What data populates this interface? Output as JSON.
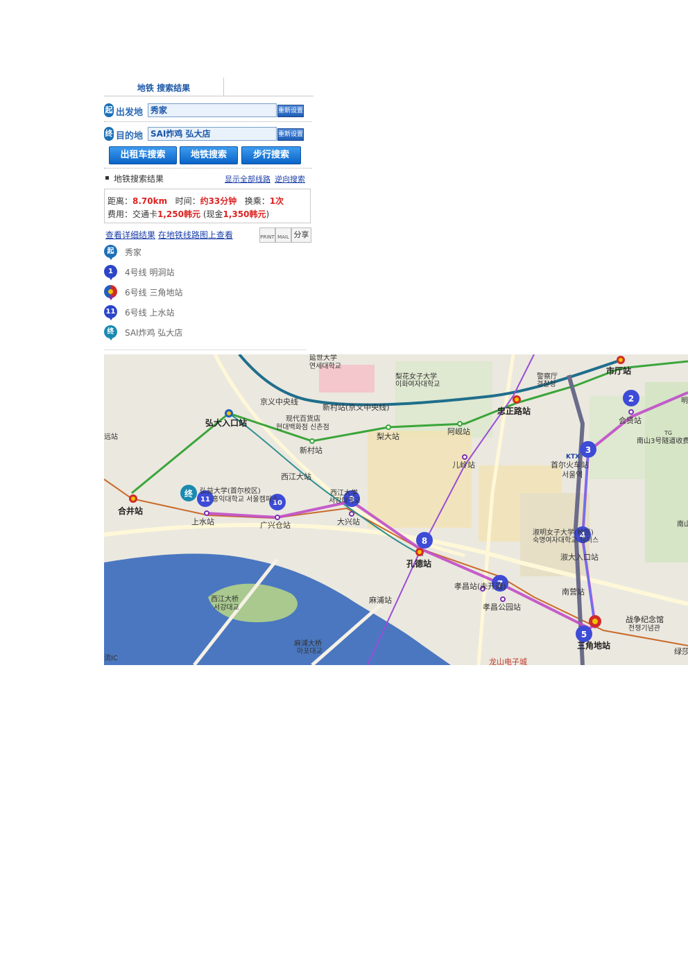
{
  "tab": {
    "label": "地铁 搜索结果"
  },
  "start": {
    "badge": "起",
    "label": "出发地",
    "value": "秀家",
    "reset": "重新设置"
  },
  "end": {
    "badge": "终",
    "label": "目的地",
    "value": "SAI炸鸡 弘大店",
    "reset": "重新设置"
  },
  "actions": {
    "taxi": "出租车搜索",
    "subway": "地铁搜索",
    "walk": "步行搜索"
  },
  "results": {
    "title": "地铁搜索结果",
    "show_all": "显示全部线路",
    "reverse": "逆向搜索",
    "distance_label": "距离：",
    "distance": "8.70km",
    "time_label": "时间：",
    "time": "约33分钟",
    "transfer_label": "换乘：",
    "transfer": "1次",
    "fare_label": "费用：交通卡",
    "fare_card": "1,250韩元",
    "fare_cash_label": "(现金",
    "fare_cash": "1,350韩元",
    "fare_close": ")"
  },
  "detail": {
    "view_detail": "查看详细结果",
    "view_map": "在地铁线路图上查看",
    "print": "PRINT",
    "mail": "MAIL",
    "share": "分享"
  },
  "steps": [
    {
      "badge": "起",
      "text": "秀家",
      "color": "#1e6fb8"
    },
    {
      "badge": "1",
      "text": "4号线 明洞站",
      "color": "#2c46c8"
    },
    {
      "badge": "",
      "text": "6号线 三角地站",
      "color": "#7a2fb0"
    },
    {
      "badge": "11",
      "text": "6号线 上水站",
      "color": "#2c46c8"
    },
    {
      "badge": "终",
      "text": "SAI炸鸡 弘大店",
      "color": "#1a8ab0"
    }
  ],
  "colors": {
    "accent": "#1a56a8",
    "route": "#c04cc8",
    "line2": "#3aa53a",
    "line6": "#a0522d",
    "river": "#4a77c0"
  },
  "map": {
    "stations": {
      "hapjeong": "合井站",
      "hongik": "弘大入口站",
      "sinchon": "新村站",
      "sinchon_gyeongui": "新村站(京义中央线)",
      "gyeongui_line": "京义中央线",
      "sogang": "西江大站",
      "sangsu": "上水站",
      "gwangheung": "广兴仓站",
      "daeheung": "大兴站",
      "gongdeok": "孔德站",
      "mapo": "麻浦站",
      "hyochang": "孝昌站(未开通)",
      "hyochangpark": "孝昌公园站",
      "ahyeon": "阿岘站",
      "edae": "梨大站",
      "aeogae": "儿岭站",
      "chungjeongno": "忠正路站",
      "cityhall": "市厅站",
      "hoehyeon": "会贤站",
      "seoulstation": "首尔火车站",
      "seoulyeok_kr": "서울역",
      "sookdae": "淑大入口站",
      "namyeong": "南营站",
      "samgakji": "三角地站",
      "nokyeong": "绿莎"
    },
    "places": {
      "yonsei": "延世大学",
      "yonsei_kr": "연세대학교",
      "ewha": "梨花女子大学",
      "ewha_kr": "이화여자대학교",
      "police": "警察厅",
      "police_kr": "경찰청",
      "hyundai": "现代百货店",
      "hyundai_kr": "현대백화점 신촌점",
      "hongik_univ": "弘益大学(首尔校区)",
      "hongik_univ_kr": "홍익대학교 서울캠퍼스",
      "sogang_univ": "西江大学",
      "sogang_univ_kr": "서강대학교",
      "sookmyung": "淑明女子大学(校区)",
      "sookmyung_kr": "숙명여자대학교 캠퍼스",
      "war_memorial": "战争纪念馆",
      "war_memorial_kr": "전쟁기념관",
      "seogang_bridge": "西江大桥",
      "seogang_bridge_kr": "서강대교",
      "mapo_bridge": "麻浦大桥",
      "mapo_bridge_kr": "마포대교",
      "yongsan": "龙山电子城",
      "tunnel": "南山3号隧道收费",
      "ktx": "KTX",
      "ic": "流IC",
      "won": "远站",
      "ming": "明",
      "namsan": "南山",
      "tg": "TG"
    },
    "markers": {
      "m2": "2",
      "m3": "3",
      "m4": "4",
      "m5": "5",
      "m7": "7",
      "m8": "8",
      "m9": "9",
      "m10": "10",
      "m11": "11",
      "end": "终"
    }
  }
}
